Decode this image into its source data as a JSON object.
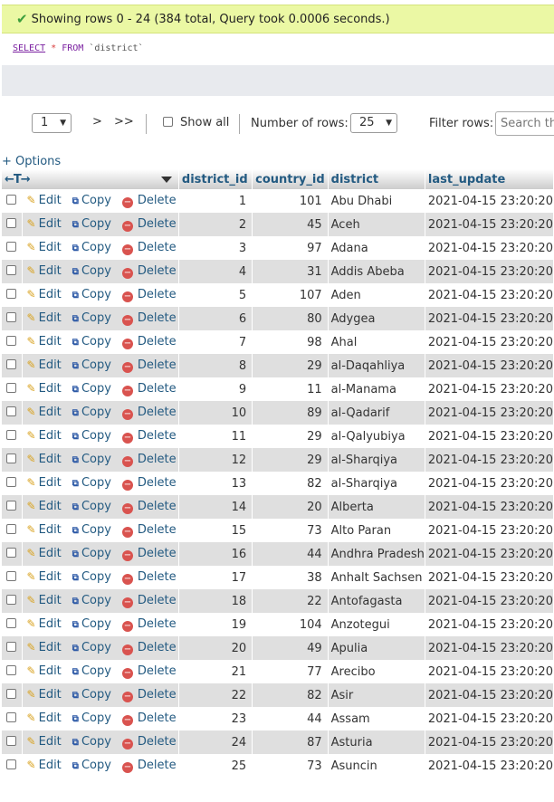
{
  "status": {
    "message": "Showing rows 0 - 24 (384 total, Query took 0.0006 seconds.)"
  },
  "sql": {
    "select": "SELECT",
    "star": "*",
    "from": "FROM",
    "table": "`district`"
  },
  "nav": {
    "page": "1",
    "next": ">",
    "last": ">>",
    "show_all": "Show all",
    "number_of_rows_label": "Number of rows:",
    "rows_value": "25",
    "filter_label": "Filter rows:",
    "search_placeholder": "Search this table"
  },
  "options_link": "+ Options",
  "table": {
    "arrows": "←T→",
    "columns": [
      "district_id",
      "country_id",
      "district",
      "last_update"
    ],
    "actions": {
      "edit": "Edit",
      "copy": "Copy",
      "delete": "Delete"
    },
    "rows": [
      [
        "1",
        "101",
        "Abu Dhabi",
        "2021-04-15 23:20:20"
      ],
      [
        "2",
        "45",
        "Aceh",
        "2021-04-15 23:20:20"
      ],
      [
        "3",
        "97",
        "Adana",
        "2021-04-15 23:20:20"
      ],
      [
        "4",
        "31",
        "Addis Abeba",
        "2021-04-15 23:20:20"
      ],
      [
        "5",
        "107",
        "Aden",
        "2021-04-15 23:20:20"
      ],
      [
        "6",
        "80",
        "Adygea",
        "2021-04-15 23:20:20"
      ],
      [
        "7",
        "98",
        "Ahal",
        "2021-04-15 23:20:20"
      ],
      [
        "8",
        "29",
        "al-Daqahliya",
        "2021-04-15 23:20:20"
      ],
      [
        "9",
        "11",
        "al-Manama",
        "2021-04-15 23:20:20"
      ],
      [
        "10",
        "89",
        "al-Qadarif",
        "2021-04-15 23:20:20"
      ],
      [
        "11",
        "29",
        "al-Qalyubiya",
        "2021-04-15 23:20:20"
      ],
      [
        "12",
        "29",
        "al-Sharqiya",
        "2021-04-15 23:20:20"
      ],
      [
        "13",
        "82",
        "al-Sharqiya",
        "2021-04-15 23:20:20"
      ],
      [
        "14",
        "20",
        "Alberta",
        "2021-04-15 23:20:20"
      ],
      [
        "15",
        "73",
        "Alto Paran",
        "2021-04-15 23:20:20"
      ],
      [
        "16",
        "44",
        "Andhra Pradesh",
        "2021-04-15 23:20:20"
      ],
      [
        "17",
        "38",
        "Anhalt Sachsen",
        "2021-04-15 23:20:20"
      ],
      [
        "18",
        "22",
        "Antofagasta",
        "2021-04-15 23:20:20"
      ],
      [
        "19",
        "104",
        "Anzotegui",
        "2021-04-15 23:20:20"
      ],
      [
        "20",
        "49",
        "Apulia",
        "2021-04-15 23:20:20"
      ],
      [
        "21",
        "77",
        "Arecibo",
        "2021-04-15 23:20:20"
      ],
      [
        "22",
        "82",
        "Asir",
        "2021-04-15 23:20:20"
      ],
      [
        "23",
        "44",
        "Assam",
        "2021-04-15 23:20:20"
      ],
      [
        "24",
        "87",
        "Asturia",
        "2021-04-15 23:20:20"
      ],
      [
        "25",
        "73",
        "Asuncin",
        "2021-04-15 23:20:20"
      ]
    ]
  }
}
